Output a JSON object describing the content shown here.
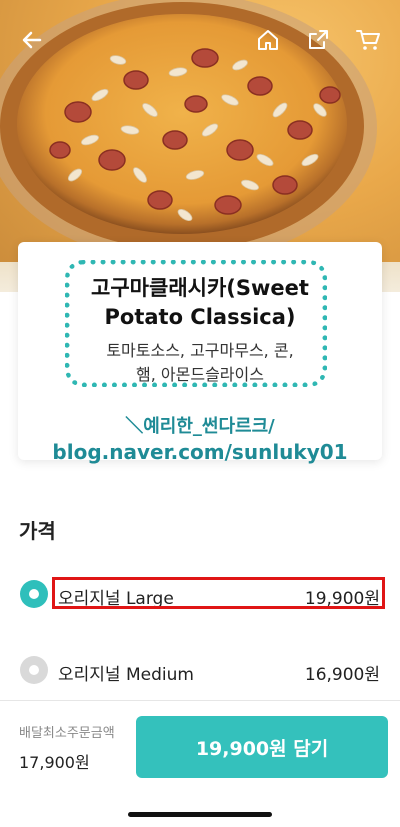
{
  "header": {
    "icons": [
      "back-arrow-icon",
      "home-icon",
      "share-icon",
      "cart-icon"
    ]
  },
  "product": {
    "name": "고구마클래시카(Sweet Potato Classica)",
    "name_line1": "고구마클래시카(Sweet",
    "name_line2": "Potato Classica)",
    "desc_line1": "토마토소스, 고구마무스, 콘,",
    "desc_line2": "햄, 아몬드슬라이스"
  },
  "watermark": {
    "line1": "＼예리한_썬다르크/",
    "line2": "blog.naver.com/sunluky01"
  },
  "price_section": {
    "title": "가격",
    "options": [
      {
        "label": "오리지널 Large",
        "price": "19,900원",
        "selected": true
      },
      {
        "label": "오리지널  Medium",
        "price": "16,900원",
        "selected": false
      }
    ]
  },
  "footer": {
    "min_order_label": "배달최소주문금액",
    "min_order_value": "17,900원",
    "add_button": "19,900원 담기"
  },
  "colors": {
    "accent": "#34c1bc",
    "highlight_box": "#e01515"
  }
}
